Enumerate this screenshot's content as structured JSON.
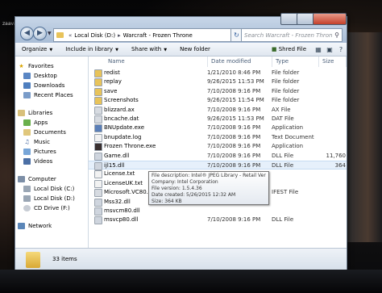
{
  "desktop": {
    "corner_label": "zaava"
  },
  "address": {
    "crumbs": [
      "Local Disk (D:)",
      "Warcraft - Frozen Throne"
    ],
    "search_placeholder": "Search Warcraft - Frozen Throne"
  },
  "toolbar": {
    "organize": "Organize",
    "include": "Include in library",
    "share": "Share with",
    "new_folder": "New folder",
    "shred": "Shred File"
  },
  "sidebar": {
    "favorites": "Favorites",
    "fav_items": [
      "Desktop",
      "Downloads",
      "Recent Places"
    ],
    "libraries": "Libraries",
    "lib_items": [
      "Apps",
      "Documents",
      "Music",
      "Pictures",
      "Videos"
    ],
    "computer": "Computer",
    "comp_items": [
      "Local Disk (C:)",
      "Local Disk (D:)",
      "CD Drive (F:)"
    ],
    "network": "Network"
  },
  "columns": {
    "name": "Name",
    "date": "Date modified",
    "type": "Type",
    "size": "Size"
  },
  "files": [
    {
      "name": "redist",
      "date": "1/21/2010 8:46 PM",
      "type": "File folder",
      "size": "",
      "icon": "folder-icon"
    },
    {
      "name": "replay",
      "date": "9/26/2015 11:53 PM",
      "type": "File folder",
      "size": "",
      "icon": "folder-icon"
    },
    {
      "name": "save",
      "date": "7/10/2008 9:16 PM",
      "type": "File folder",
      "size": "",
      "icon": "folder-icon"
    },
    {
      "name": "Screenshots",
      "date": "9/26/2015 11:54 PM",
      "type": "File folder",
      "size": "",
      "icon": "folder-icon"
    },
    {
      "name": "blizzard.ax",
      "date": "7/10/2008 9:16 PM",
      "type": "AX File",
      "size": "",
      "icon": "file-icon"
    },
    {
      "name": "bncache.dat",
      "date": "9/26/2015 11:53 PM",
      "type": "DAT File",
      "size": "",
      "icon": "file-icon"
    },
    {
      "name": "BNUpdate.exe",
      "date": "7/10/2008 9:16 PM",
      "type": "Application",
      "size": "",
      "icon": "app-icon"
    },
    {
      "name": "bnupdate.log",
      "date": "7/10/2008 9:16 PM",
      "type": "Text Document",
      "size": "",
      "icon": "text-icon"
    },
    {
      "name": "Frozen Throne.exe",
      "date": "7/10/2008 9:16 PM",
      "type": "Application",
      "size": "",
      "icon": "game-icon"
    },
    {
      "name": "Game.dll",
      "date": "7/10/2008 9:16 PM",
      "type": "DLL File",
      "size": "11,760",
      "icon": "dll-icon"
    },
    {
      "name": "ijl15.dll",
      "date": "7/10/2008 9:16 PM",
      "type": "DLL File",
      "size": "364",
      "icon": "dll-icon"
    },
    {
      "name": "License.txt",
      "date": "",
      "type": "",
      "size": "",
      "icon": "text-icon"
    },
    {
      "name": "LicenseUK.txt",
      "date": "",
      "type": "",
      "size": "",
      "icon": "text-icon"
    },
    {
      "name": "Microsoft.VC80.CR",
      "date": "",
      "type": "IFEST File",
      "size": "",
      "icon": "file-icon"
    },
    {
      "name": "Mss32.dll",
      "date": "",
      "type": "",
      "size": "",
      "icon": "dll-icon"
    },
    {
      "name": "msvcm80.dll",
      "date": "",
      "type": "",
      "size": "",
      "icon": "dll-icon"
    },
    {
      "name": "msvcp80.dll",
      "date": "7/10/2008 9:16 PM",
      "type": "DLL File",
      "size": "",
      "icon": "dll-icon"
    }
  ],
  "tooltip": {
    "line1": "File description: Intel® JPEG Library - Retail Version",
    "line2": "Company: Intel Corporation",
    "line3": "File version: 1.5.4.36",
    "line4": "Date created: 5/26/2015 12:32 AM",
    "line5": "Size: 364 KB"
  },
  "status": {
    "count": "33 items"
  },
  "colors": {
    "folder": "#e8c35a",
    "accent": "#c6dbf2"
  }
}
